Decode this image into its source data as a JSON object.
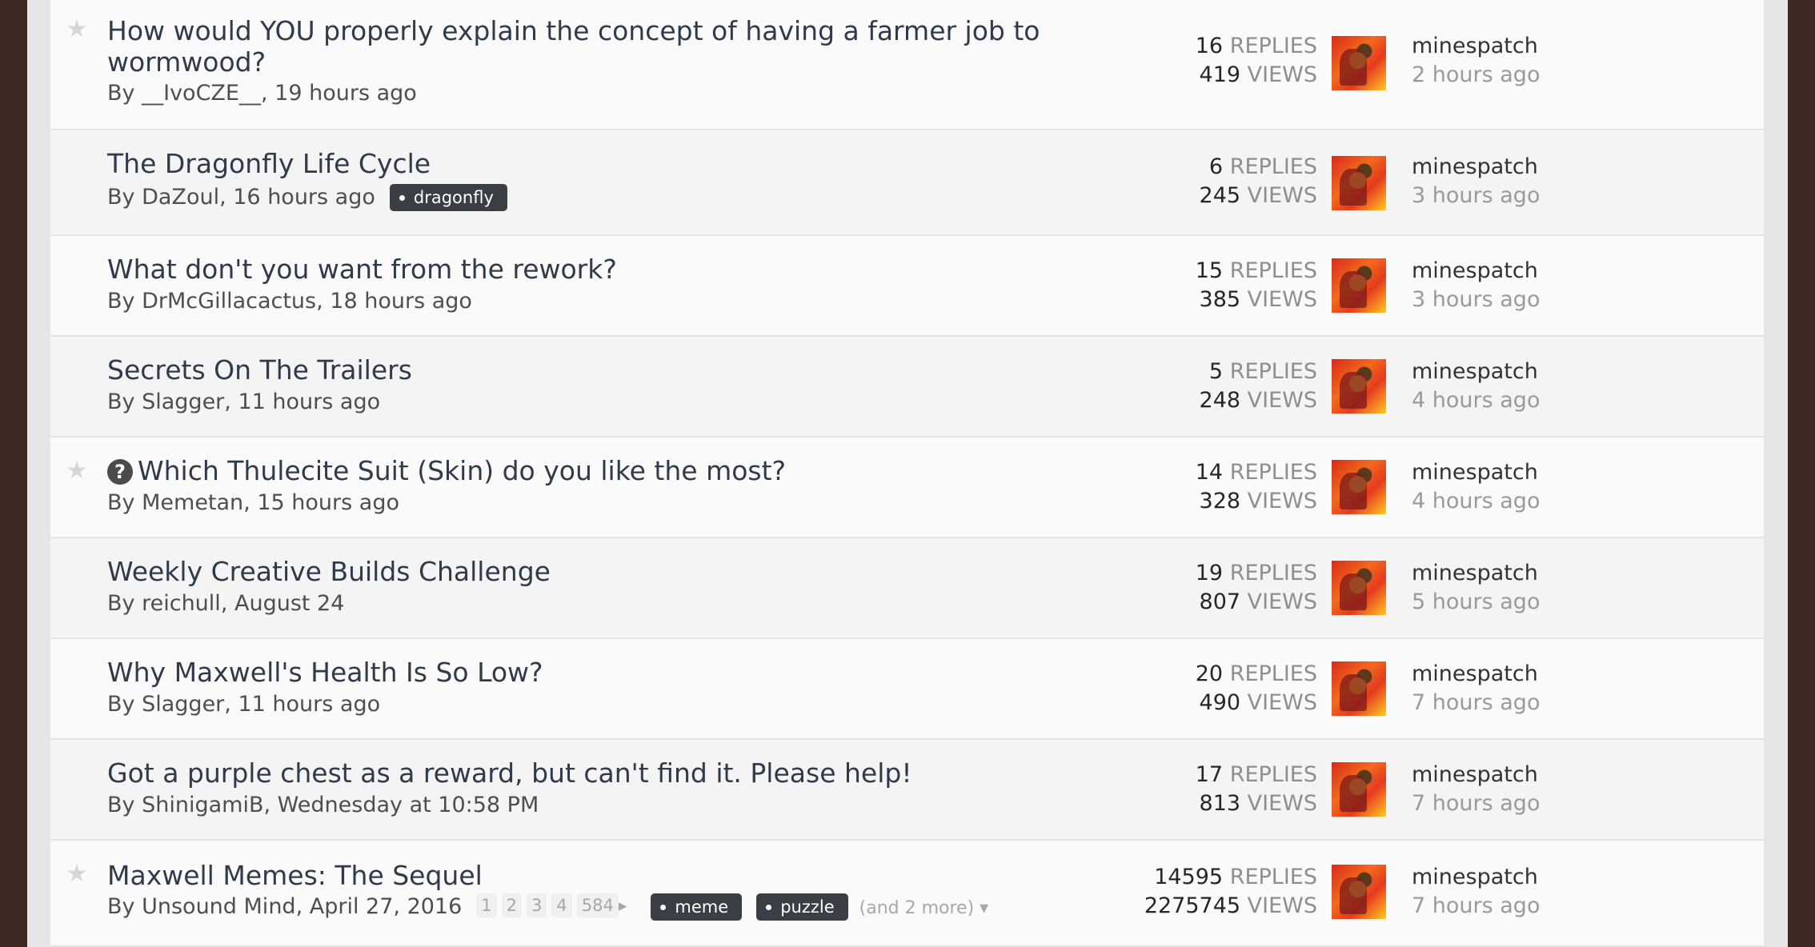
{
  "topics": [
    {
      "star": true,
      "question": false,
      "title": "How would YOU properly explain the concept of having a farmer job to wormwood?",
      "author": "__IvoCZE__",
      "date": "19 hours ago",
      "tags": [],
      "pages": [],
      "more": "",
      "replies": "16",
      "views": "419",
      "last_user": "minespatch",
      "last_time": "2 hours ago"
    },
    {
      "star": false,
      "question": false,
      "title": "The Dragonfly Life Cycle",
      "author": "DaZoul",
      "date": "16 hours ago",
      "tags": [
        "dragonfly"
      ],
      "pages": [],
      "more": "",
      "replies": "6",
      "views": "245",
      "last_user": "minespatch",
      "last_time": "3 hours ago"
    },
    {
      "star": false,
      "question": false,
      "title": "What don't you want from the rework?",
      "author": "DrMcGillacactus",
      "date": "18 hours ago",
      "tags": [],
      "pages": [],
      "more": "",
      "replies": "15",
      "views": "385",
      "last_user": "minespatch",
      "last_time": "3 hours ago"
    },
    {
      "star": false,
      "question": false,
      "title": "Secrets On The Trailers",
      "author": "Slagger",
      "date": "11 hours ago",
      "tags": [],
      "pages": [],
      "more": "",
      "replies": "5",
      "views": "248",
      "last_user": "minespatch",
      "last_time": "4 hours ago"
    },
    {
      "star": true,
      "question": true,
      "title": "Which Thulecite Suit (Skin) do you like the most?",
      "author": "Memetan",
      "date": "15 hours ago",
      "tags": [],
      "pages": [],
      "more": "",
      "replies": "14",
      "views": "328",
      "last_user": "minespatch",
      "last_time": "4 hours ago"
    },
    {
      "star": false,
      "question": false,
      "title": "Weekly Creative Builds Challenge",
      "author": "reichull",
      "date": "August 24",
      "tags": [],
      "pages": [],
      "more": "",
      "replies": "19",
      "views": "807",
      "last_user": "minespatch",
      "last_time": "5 hours ago"
    },
    {
      "star": false,
      "question": false,
      "title": "Why Maxwell's Health Is So Low?",
      "author": "Slagger",
      "date": "11 hours ago",
      "tags": [],
      "pages": [],
      "more": "",
      "replies": "20",
      "views": "490",
      "last_user": "minespatch",
      "last_time": "7 hours ago"
    },
    {
      "star": false,
      "question": false,
      "title": "Got a purple chest as a reward, but can't find it. Please help!",
      "author": "ShinigamiB",
      "date": "Wednesday at 10:58 PM",
      "tags": [],
      "pages": [],
      "more": "",
      "replies": "17",
      "views": "813",
      "last_user": "minespatch",
      "last_time": "7 hours ago"
    },
    {
      "star": true,
      "question": false,
      "title": "Maxwell Memes: The Sequel",
      "author": "Unsound Mind",
      "date": "April 27, 2016",
      "tags": [
        "meme",
        "puzzle"
      ],
      "pages": [
        "1",
        "2",
        "3",
        "4",
        "584"
      ],
      "more": "(and 2 more)",
      "replies": "14595",
      "views": "2275745",
      "last_user": "minespatch",
      "last_time": "7 hours ago"
    }
  ],
  "labels": {
    "by": "By",
    "replies": "REPLIES",
    "views": "VIEWS"
  },
  "icons": {
    "star": "star-icon",
    "question": "question-icon",
    "caret": "caret-down-icon",
    "page_next": "caret-right-icon"
  },
  "colors": {
    "background": "#3d2a23",
    "tag": "#3a3f45",
    "title": "#2f3b4a"
  }
}
